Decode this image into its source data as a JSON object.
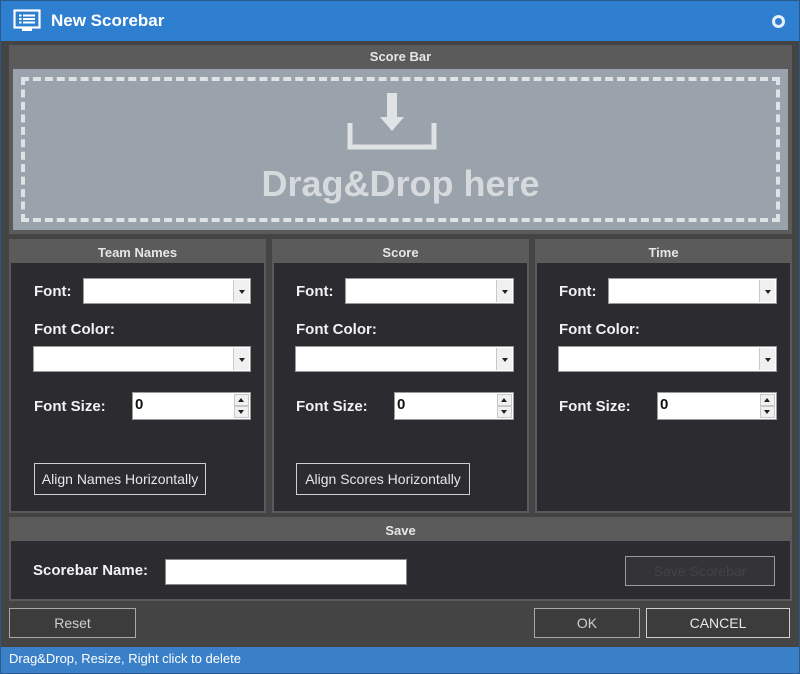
{
  "window": {
    "title": "New Scorebar"
  },
  "scorebar": {
    "header": "Score Bar",
    "drop_text": "Drag&Drop here"
  },
  "panels": [
    {
      "header": "Team Names",
      "font_label": "Font:",
      "font_value": "",
      "color_label": "Font Color:",
      "color_value": "",
      "size_label": "Font Size:",
      "size_value": "0",
      "align_button": "Align Names Horizontally"
    },
    {
      "header": "Score",
      "font_label": "Font:",
      "font_value": "",
      "color_label": "Font Color:",
      "color_value": "",
      "size_label": "Font Size:",
      "size_value": "0",
      "align_button": "Align Scores Horizontally"
    },
    {
      "header": "Time",
      "font_label": "Font:",
      "font_value": "",
      "color_label": "Font Color:",
      "color_value": "",
      "size_label": "Font Size:",
      "size_value": "0"
    }
  ],
  "save": {
    "header": "Save",
    "name_label": "Scorebar Name:",
    "name_value": "",
    "save_button": "Save Scorebar"
  },
  "footer": {
    "reset": "Reset",
    "ok": "OK",
    "cancel": "CANCEL"
  },
  "status": {
    "text": "Drag&Drop,  Resize,  Right click to delete"
  },
  "colors": {
    "title_bar": "#2f7fd0",
    "status_bar": "#3a80c8",
    "panel_bg": "#2b2b30",
    "drop_zone": "#9aa3ab"
  },
  "icons": {
    "app": "list-window-icon",
    "drop": "download-tray-icon",
    "window_button": "circle-icon"
  }
}
